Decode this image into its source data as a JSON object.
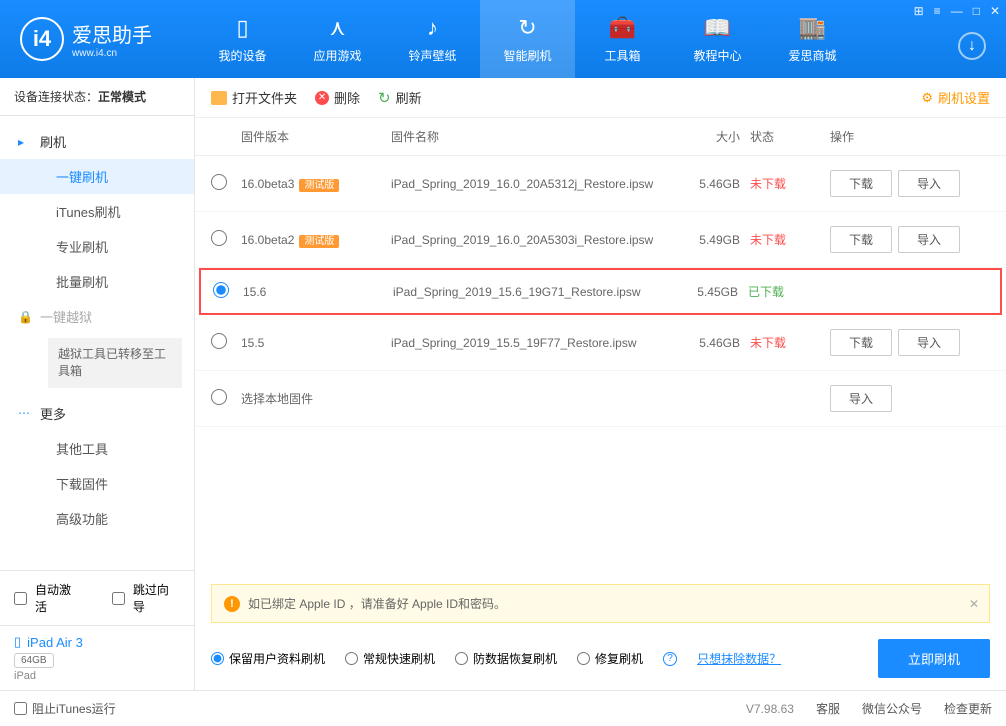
{
  "header": {
    "logo_cn": "爱思助手",
    "logo_url": "www.i4.cn",
    "tabs": [
      "我的设备",
      "应用游戏",
      "铃声壁纸",
      "智能刷机",
      "工具箱",
      "教程中心",
      "爱思商城"
    ]
  },
  "sidebar": {
    "status_label": "设备连接状态：",
    "status_mode": "正常模式",
    "groups": {
      "flash": {
        "label": "刷机",
        "items": [
          "一键刷机",
          "iTunes刷机",
          "专业刷机",
          "批量刷机"
        ]
      },
      "jailbreak": {
        "label": "一键越狱",
        "note": "越狱工具已转移至工具箱"
      },
      "more": {
        "label": "更多",
        "items": [
          "其他工具",
          "下载固件",
          "高级功能"
        ]
      }
    },
    "auto_activate": "自动激活",
    "skip_guide": "跳过向导",
    "device_name": "iPad Air 3",
    "device_cap": "64GB",
    "device_type": "iPad"
  },
  "toolbar": {
    "open_folder": "打开文件夹",
    "delete": "删除",
    "refresh": "刷新",
    "settings": "刷机设置"
  },
  "table": {
    "headers": {
      "version": "固件版本",
      "name": "固件名称",
      "size": "大小",
      "status": "状态",
      "ops": "操作"
    },
    "rows": [
      {
        "ver": "16.0beta3",
        "beta": true,
        "name": "iPad_Spring_2019_16.0_20A5312j_Restore.ipsw",
        "size": "5.46GB",
        "status": "未下载",
        "downloaded": false,
        "selected": false
      },
      {
        "ver": "16.0beta2",
        "beta": true,
        "name": "iPad_Spring_2019_16.0_20A5303i_Restore.ipsw",
        "size": "5.49GB",
        "status": "未下载",
        "downloaded": false,
        "selected": false
      },
      {
        "ver": "15.6",
        "beta": false,
        "name": "iPad_Spring_2019_15.6_19G71_Restore.ipsw",
        "size": "5.45GB",
        "status": "已下载",
        "downloaded": true,
        "selected": true,
        "highlighted": true
      },
      {
        "ver": "15.5",
        "beta": false,
        "name": "iPad_Spring_2019_15.5_19F77_Restore.ipsw",
        "size": "5.46GB",
        "status": "未下载",
        "downloaded": false,
        "selected": false
      }
    ],
    "local_row": "选择本地固件",
    "beta_badge": "测试版",
    "btn_download": "下载",
    "btn_import": "导入"
  },
  "alert": "如已绑定 Apple ID ，请准备好 Apple ID和密码。",
  "options": {
    "opt1": "保留用户资料刷机",
    "opt2": "常规快速刷机",
    "opt3": "防数据恢复刷机",
    "opt4": "修复刷机",
    "erase_link": "只想抹除数据？",
    "flash_btn": "立即刷机"
  },
  "footer": {
    "block_itunes": "阻止iTunes运行",
    "version": "V7.98.63",
    "support": "客服",
    "wechat": "微信公众号",
    "update": "检查更新"
  }
}
